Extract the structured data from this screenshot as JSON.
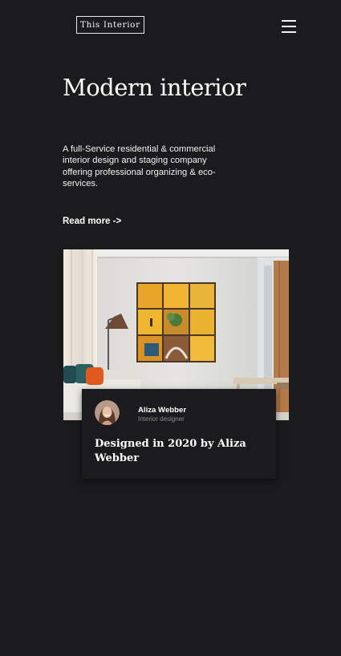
{
  "header": {
    "logo_text": "This Interior",
    "menu_icon": "hamburger-menu-icon"
  },
  "hero": {
    "title": "Modern interior",
    "description": "A full-Service residential & commercial interior design and staging company offering professional organizing & eco-services.",
    "read_more": "Read more ->"
  },
  "feature": {
    "author": {
      "name": "Aliza Webber",
      "role": "Interior designer"
    },
    "title": "Designed in 2020 by Aliza Webber"
  },
  "colors": {
    "background": "#1b1b1d",
    "text": "#ffffff",
    "muted_text": "#8c8c8c"
  }
}
